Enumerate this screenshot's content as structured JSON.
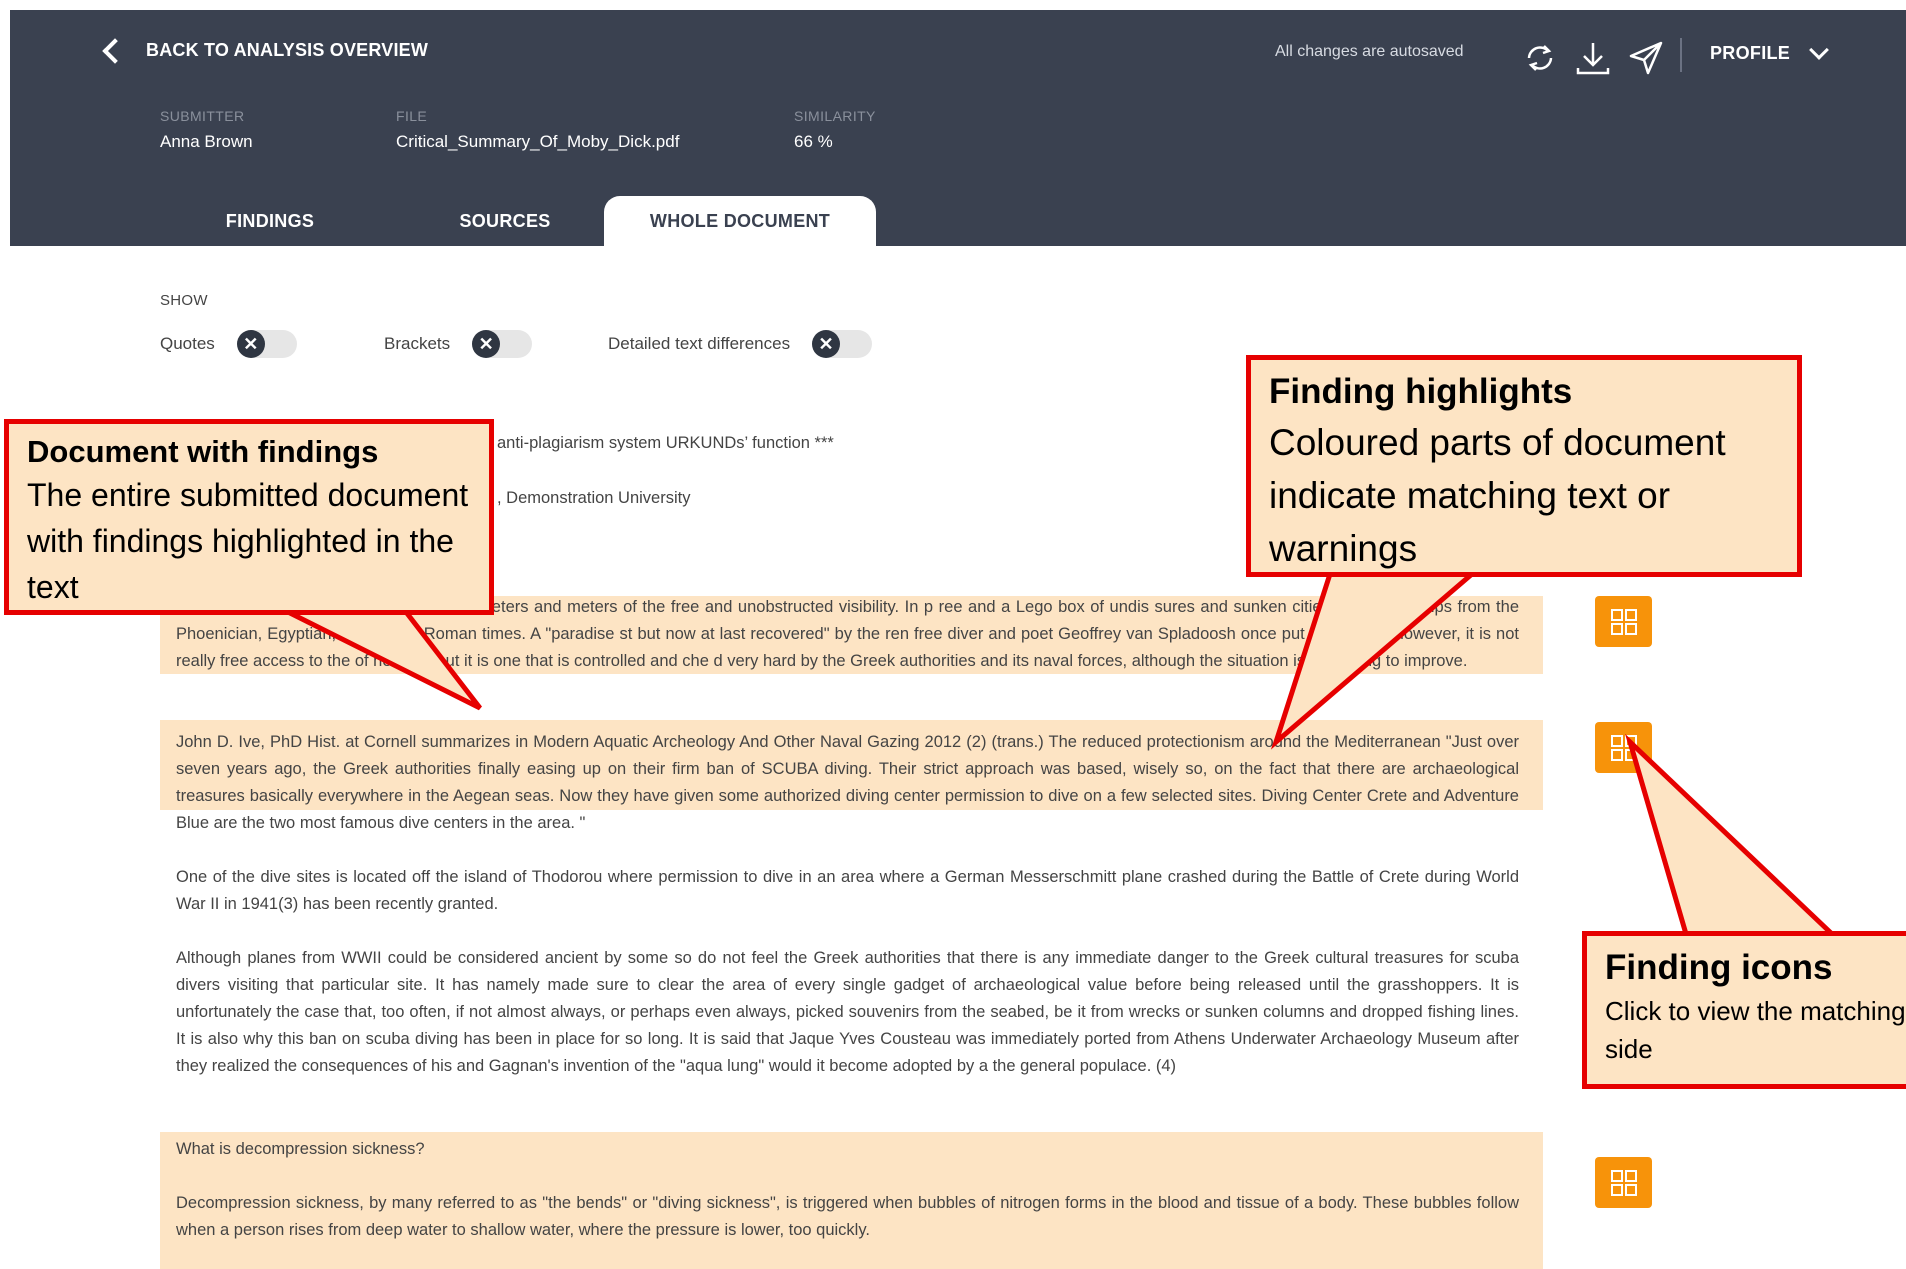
{
  "header": {
    "back_label": "BACK TO ANALYSIS OVERVIEW",
    "autosave_text": "All changes are autosaved",
    "icons": [
      "refresh-icon",
      "download-icon",
      "send-icon"
    ],
    "profile_label": "PROFILE",
    "meta": {
      "submitter_label": "SUBMITTER",
      "submitter_value": "Anna Brown",
      "file_label": "FILE",
      "file_value": "Critical_Summary_Of_Moby_Dick.pdf",
      "similarity_label": "SIMILARITY",
      "similarity_value": "66 %"
    },
    "tabs": [
      {
        "label": "FINDINGS",
        "active": false
      },
      {
        "label": "SOURCES",
        "active": false
      },
      {
        "label": "WHOLE DOCUMENT",
        "active": true
      }
    ]
  },
  "filters": {
    "show_label": "SHOW",
    "items": [
      {
        "label": "Quotes",
        "enabled": false
      },
      {
        "label": "Brackets",
        "enabled": false
      },
      {
        "label": "Detailed text differences",
        "enabled": false
      }
    ],
    "toggle_off_glyph": "✕"
  },
  "document": {
    "line1": "anti-plagiarism system URKUNDs’ function ***",
    "line2": ", Demonstration University",
    "p1": "en for the world divers. Clear water with meters and meters of the free and unobstructed visibility. In p                                ree and a Lego box of undis               sures and sunken cities and lower ships from the Phoenician, Egyptian, Greek and Roman times. A \"paradise               st but now at last recovered\" by the ren           free diver and poet Geoffrey van Spladoosh once put it. (1) Now, however, it is not really free access to the                 of heaven, but it is one that is controlled and che        d very hard by the Greek authorities and its naval forces, although the situation is beginning to improve.",
    "p2": "John D. Ive, PhD Hist. at Cornell summarizes in Modern Aquatic Archeology And Other Naval Gazing 2012 (2) (trans.) The reduced protectionism around the Mediterranean \"Just over seven years ago, the Greek authorities finally easing up on their firm ban of SCUBA diving. Their strict approach was based, wisely so, on the fact that there are archaeological treasures basically everywhere in the Aegean seas. Now they have given some authorized diving center permission to dive on a few selected sites. Diving Center Crete and Adventure Blue are the two most famous dive centers in the area. \"",
    "p3": "One of the dive sites is located off the island of Thodorou where permission to dive in an area where a German Messerschmitt plane crashed during the Battle of Crete during World War II in 1941(3) has been recently granted.",
    "p4": "Although planes from WWII could be considered ancient by some so do not feel the Greek authorities that there is any immediate danger to the Greek cultural treasures for scuba divers visiting that particular site. It has namely made sure to clear the area of every single gadget of archaeological value before being released until the grasshoppers. It is unfortunately the case that, too often, if not almost always, or perhaps even always, picked souvenirs from the seabed, be it from wrecks or sunken columns and dropped fishing lines. It is also why this ban on scuba diving has been in place for so long. It is said that Jaque Yves Cousteau was immediately ported from Athens Underwater Archaeology Museum after they realized the consequences of his and Gagnan's invention of the \"aqua lung\" would it become adopted by a the general populace. (4)",
    "p5": "What is decompression sickness?",
    "p6": "Decompression sickness, by many referred to as \"the bends\" or \"diving sickness\", is triggered when bubbles of nitrogen forms in the blood and tissue of a body. These bubbles follow when a person rises from deep water to shallow water, where the pressure is lower, too quickly.",
    "highlight_color": "#fde4c4",
    "finding_icon_color": "#f7930a"
  },
  "callouts": {
    "doc": {
      "title": "Document with findings",
      "body": "The entire submitted document with findings highlighted in the text"
    },
    "highlights": {
      "title": "Finding highlights",
      "body": "Coloured parts of document indicate matching text or warnings"
    },
    "icons": {
      "title": "Finding icons",
      "body": "Click to view the matching side"
    },
    "border_color": "#e60000"
  }
}
